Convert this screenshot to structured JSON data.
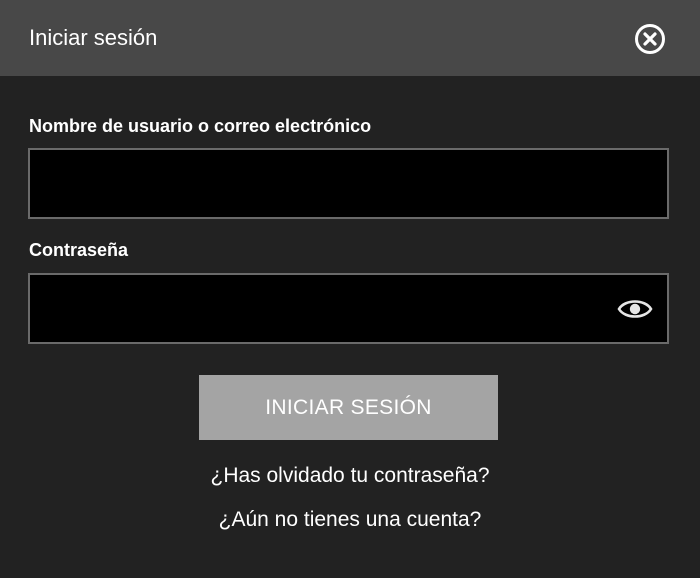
{
  "header": {
    "title": "Iniciar sesión",
    "close_icon": "close-circle-icon"
  },
  "form": {
    "username_label": "Nombre de usuario o correo electrónico",
    "username_value": "",
    "password_label": "Contraseña",
    "password_value": "",
    "show_password_icon": "eye-icon",
    "submit_label": "INICIAR SESIÓN"
  },
  "links": {
    "forgot_password": "¿Has olvidado tu contraseña?",
    "no_account": "¿Aún no tienes una cuenta?"
  },
  "colors": {
    "background": "#222222",
    "header_background": "#484848",
    "input_background": "#000000",
    "input_border": "#6a6a6a",
    "button_background": "#a4a4a4",
    "text": "#ffffff"
  }
}
